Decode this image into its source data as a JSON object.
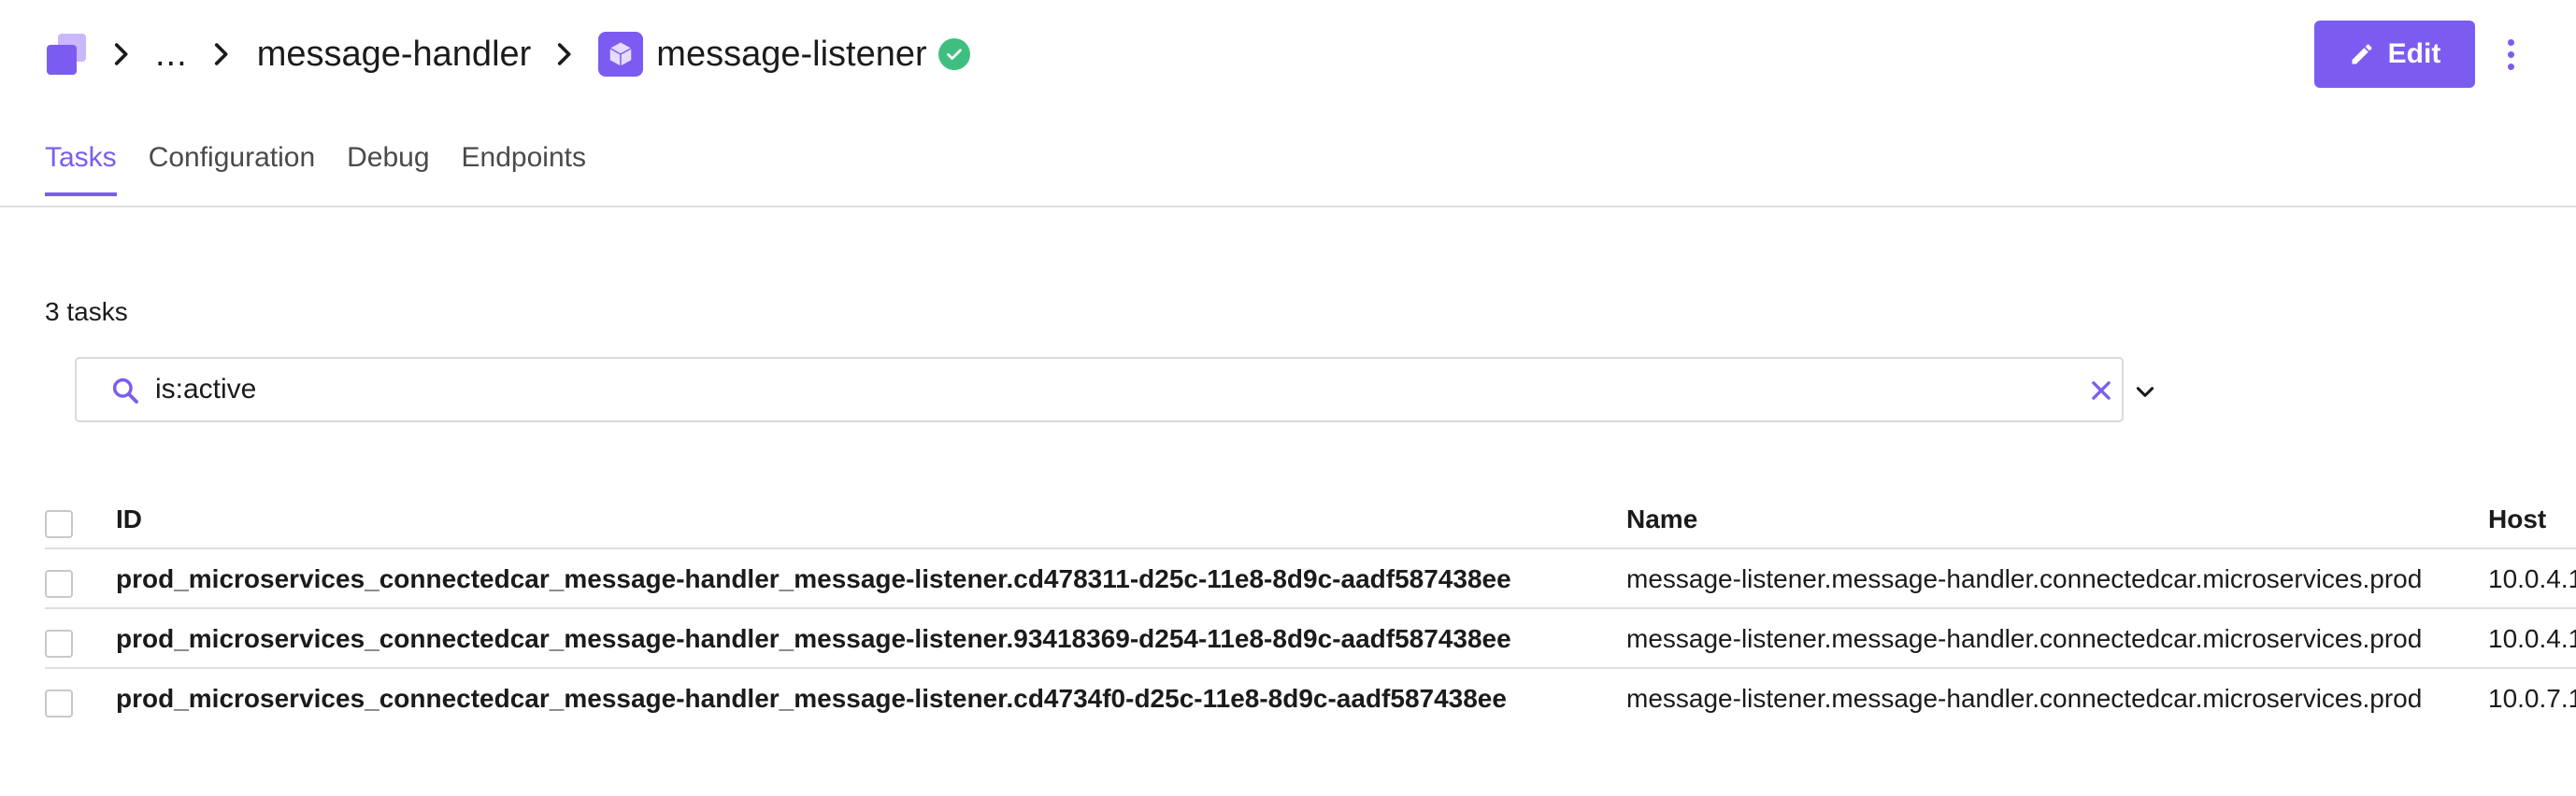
{
  "header": {
    "ellipsis": "...",
    "parent": "message-handler",
    "service": "message-listener",
    "edit_label": "Edit"
  },
  "tabs": [
    {
      "label": "Tasks",
      "active": true
    },
    {
      "label": "Configuration",
      "active": false
    },
    {
      "label": "Debug",
      "active": false
    },
    {
      "label": "Endpoints",
      "active": false
    }
  ],
  "task_count": "3 tasks",
  "filter": {
    "value": "is:active"
  },
  "table": {
    "columns": {
      "id": "ID",
      "name": "Name",
      "host": "Host"
    },
    "rows": [
      {
        "id": "prod_microservices_connectedcar_message-handler_message-listener.cd478311-d25c-11e8-8d9c-aadf587438ee",
        "name": "message-listener.message-handler.connectedcar.microservices.prod",
        "host": "10.0.4.1"
      },
      {
        "id": "prod_microservices_connectedcar_message-handler_message-listener.93418369-d254-11e8-8d9c-aadf587438ee",
        "name": "message-listener.message-handler.connectedcar.microservices.prod",
        "host": "10.0.4.1"
      },
      {
        "id": "prod_microservices_connectedcar_message-handler_message-listener.cd4734f0-d25c-11e8-8d9c-aadf587438ee",
        "name": "message-listener.message-handler.connectedcar.microservices.prod",
        "host": "10.0.7.1"
      }
    ]
  },
  "colors": {
    "accent": "#7c5cf0",
    "success": "#3fbf7f",
    "border": "#dedede"
  },
  "icons": [
    "app-logo-icon",
    "chevron-right-icon",
    "service-cube-icon",
    "check-circle-icon",
    "pencil-icon",
    "more-vertical-icon",
    "search-icon",
    "close-icon",
    "chevron-down-icon"
  ]
}
